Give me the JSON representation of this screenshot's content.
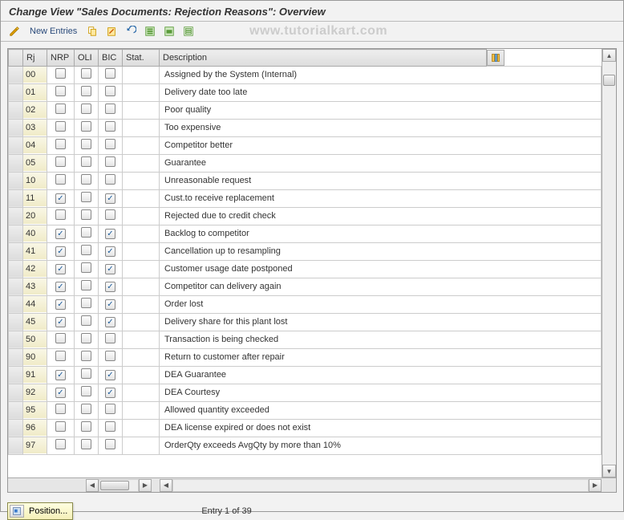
{
  "title": "Change View \"Sales Documents: Rejection Reasons\": Overview",
  "toolbar": {
    "new_entries": "New Entries"
  },
  "watermark": "www.tutorialkart.com",
  "columns": {
    "rj": "Rj",
    "nrp": "NRP",
    "oli": "OLI",
    "bic": "BIC",
    "stat": "Stat.",
    "desc": "Description"
  },
  "chart_data": {
    "type": "table",
    "title": "Sales Documents: Rejection Reasons",
    "columns": [
      "Rj",
      "NRP",
      "OLI",
      "BIC",
      "Stat.",
      "Description"
    ],
    "rows": [
      {
        "rj": "00",
        "nrp": false,
        "oli": false,
        "bic": false,
        "stat": "",
        "desc": "Assigned by the System (Internal)"
      },
      {
        "rj": "01",
        "nrp": false,
        "oli": false,
        "bic": false,
        "stat": "",
        "desc": "Delivery date too late"
      },
      {
        "rj": "02",
        "nrp": false,
        "oli": false,
        "bic": false,
        "stat": "",
        "desc": "Poor quality"
      },
      {
        "rj": "03",
        "nrp": false,
        "oli": false,
        "bic": false,
        "stat": "",
        "desc": "Too expensive"
      },
      {
        "rj": "04",
        "nrp": false,
        "oli": false,
        "bic": false,
        "stat": "",
        "desc": "Competitor better"
      },
      {
        "rj": "05",
        "nrp": false,
        "oli": false,
        "bic": false,
        "stat": "",
        "desc": "Guarantee"
      },
      {
        "rj": "10",
        "nrp": false,
        "oli": false,
        "bic": false,
        "stat": "",
        "desc": "Unreasonable request"
      },
      {
        "rj": "11",
        "nrp": true,
        "oli": false,
        "bic": true,
        "stat": "",
        "desc": "Cust.to receive replacement"
      },
      {
        "rj": "20",
        "nrp": false,
        "oli": false,
        "bic": false,
        "stat": "",
        "desc": "Rejected due to credit check"
      },
      {
        "rj": "40",
        "nrp": true,
        "oli": false,
        "bic": true,
        "stat": "",
        "desc": "Backlog to competitor"
      },
      {
        "rj": "41",
        "nrp": true,
        "oli": false,
        "bic": true,
        "stat": "",
        "desc": "Cancellation up to resampling"
      },
      {
        "rj": "42",
        "nrp": true,
        "oli": false,
        "bic": true,
        "stat": "",
        "desc": "Customer usage date postponed"
      },
      {
        "rj": "43",
        "nrp": true,
        "oli": false,
        "bic": true,
        "stat": "",
        "desc": "Competitor can delivery again"
      },
      {
        "rj": "44",
        "nrp": true,
        "oli": false,
        "bic": true,
        "stat": "",
        "desc": "Order lost"
      },
      {
        "rj": "45",
        "nrp": true,
        "oli": false,
        "bic": true,
        "stat": "",
        "desc": "Delivery share for this plant lost"
      },
      {
        "rj": "50",
        "nrp": false,
        "oli": false,
        "bic": false,
        "stat": "",
        "desc": "Transaction is being checked"
      },
      {
        "rj": "90",
        "nrp": false,
        "oli": false,
        "bic": false,
        "stat": "",
        "desc": "Return to customer after repair"
      },
      {
        "rj": "91",
        "nrp": true,
        "oli": false,
        "bic": true,
        "stat": "",
        "desc": "DEA Guarantee"
      },
      {
        "rj": "92",
        "nrp": true,
        "oli": false,
        "bic": true,
        "stat": "",
        "desc": "DEA Courtesy"
      },
      {
        "rj": "95",
        "nrp": false,
        "oli": false,
        "bic": false,
        "stat": "",
        "desc": "Allowed quantity exceeded"
      },
      {
        "rj": "96",
        "nrp": false,
        "oli": false,
        "bic": false,
        "stat": "",
        "desc": "DEA license expired or does not exist"
      },
      {
        "rj": "97",
        "nrp": false,
        "oli": false,
        "bic": false,
        "stat": "",
        "desc": "OrderQty exceeds AvgQty by more than 10%"
      }
    ]
  },
  "footer": {
    "position_label": "Position...",
    "entry_text": "Entry 1 of 39"
  }
}
